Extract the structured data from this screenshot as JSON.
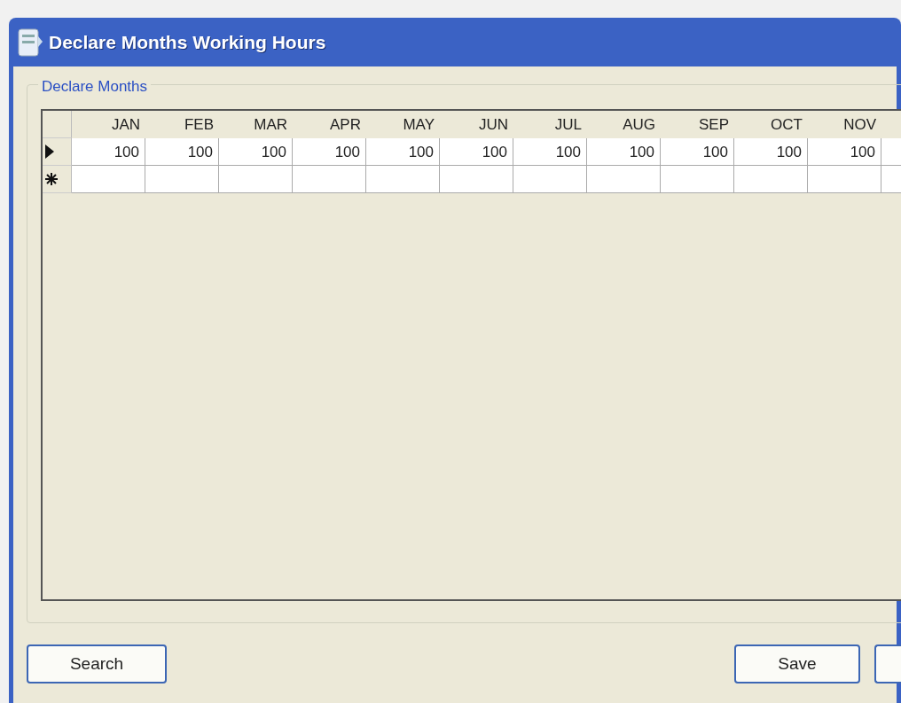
{
  "window": {
    "title": "Declare Months Working Hours"
  },
  "group": {
    "title": "Declare Months"
  },
  "table": {
    "columns": [
      "JAN",
      "FEB",
      "MAR",
      "APR",
      "MAY",
      "JUN",
      "JUL",
      "AUG",
      "SEP",
      "OCT",
      "NOV"
    ],
    "rows": [
      {
        "kind": "current",
        "cells": [
          "100",
          "100",
          "100",
          "100",
          "100",
          "100",
          "100",
          "100",
          "100",
          "100",
          "100"
        ]
      },
      {
        "kind": "new"
      }
    ]
  },
  "buttons_left": [
    {
      "label": "Search"
    }
  ],
  "buttons_right": [
    {
      "label": "Save"
    }
  ]
}
